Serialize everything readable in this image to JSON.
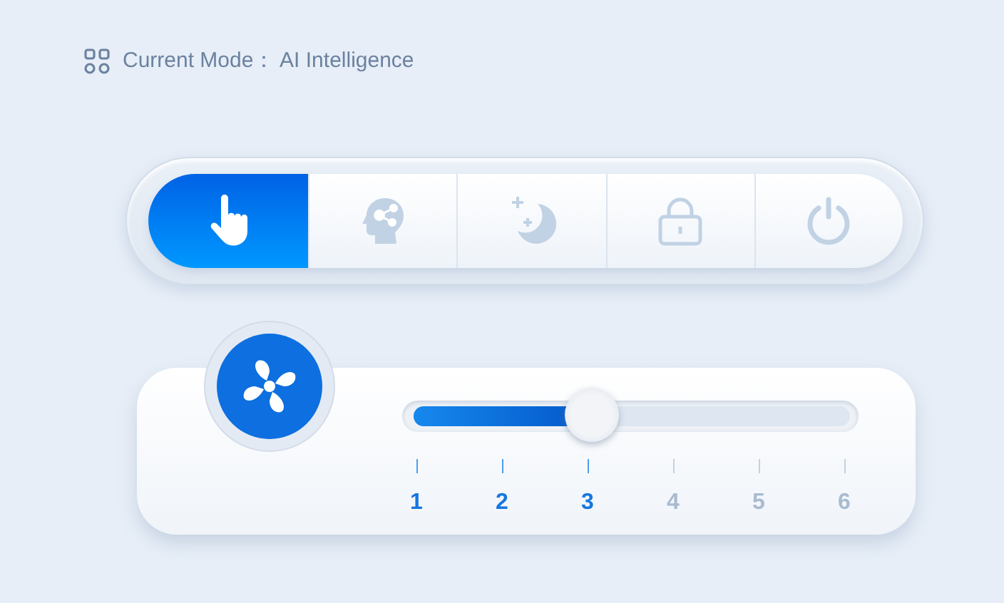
{
  "header": {
    "text": "Current Mode：  AI Intelligence"
  },
  "modes": [
    {
      "kind": "hand",
      "selected": true
    },
    {
      "kind": "brain",
      "selected": false
    },
    {
      "kind": "moon",
      "selected": false
    },
    {
      "kind": "lock",
      "selected": false
    },
    {
      "kind": "power",
      "selected": false
    }
  ],
  "fan_speed": {
    "level": 0.41,
    "steps": [
      {
        "label": "1",
        "reached": true
      },
      {
        "label": "2",
        "reached": true
      },
      {
        "label": "3",
        "reached": true
      },
      {
        "label": "4",
        "reached": false
      },
      {
        "label": "5",
        "reached": false
      },
      {
        "label": "6",
        "reached": false
      }
    ]
  }
}
